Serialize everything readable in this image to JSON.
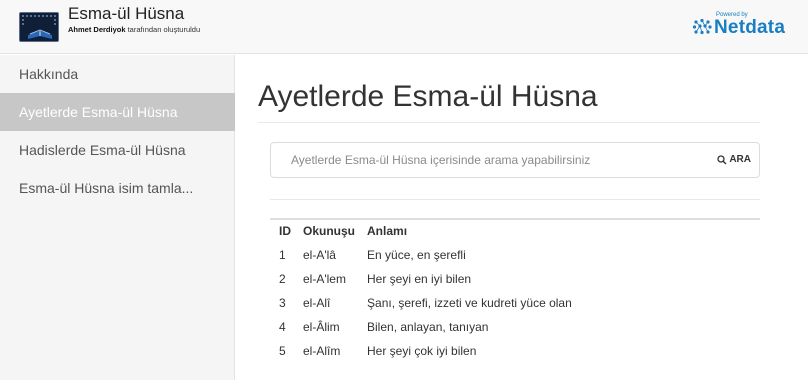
{
  "header": {
    "title": "Esma-ül Hüsna",
    "subtitle_author": "Ahmet Derdiyok",
    "subtitle_rest": " tarafından oluşturuldu",
    "powered_by": "Powered by",
    "brand": "Netdata"
  },
  "sidebar": {
    "items": [
      {
        "label": "Hakkında",
        "active": false
      },
      {
        "label": "Ayetlerde Esma-ül Hüsna",
        "active": true
      },
      {
        "label": "Hadislerde Esma-ül Hüsna",
        "active": false
      },
      {
        "label": "Esma-ül Hüsna isim tamla...",
        "active": false
      }
    ]
  },
  "main": {
    "title": "Ayetlerde Esma-ül Hüsna",
    "search": {
      "placeholder": "Ayetlerde Esma-ül Hüsna içerisinde arama yapabilirsiniz",
      "value": "",
      "button_label": "ARA"
    },
    "table": {
      "headers": [
        "ID",
        "Okunuşu",
        "Anlamı"
      ],
      "rows": [
        [
          "1",
          "el-A'lâ",
          "En yüce, en şerefli"
        ],
        [
          "2",
          "el-A'lem",
          "Her şeyi en iyi bilen"
        ],
        [
          "3",
          "el-Alî",
          "Şanı, şerefi, izzeti ve kudreti yüce olan"
        ],
        [
          "4",
          "el-Âlim",
          "Bilen, anlayan, tanıyan"
        ],
        [
          "5",
          "el-Alîm",
          "Her şeyi çok iyi bilen"
        ]
      ]
    }
  },
  "colors": {
    "accent": "#1a7fc1",
    "active_nav_bg": "#c7c7c7",
    "sidebar_bg": "#f5f5f5"
  }
}
